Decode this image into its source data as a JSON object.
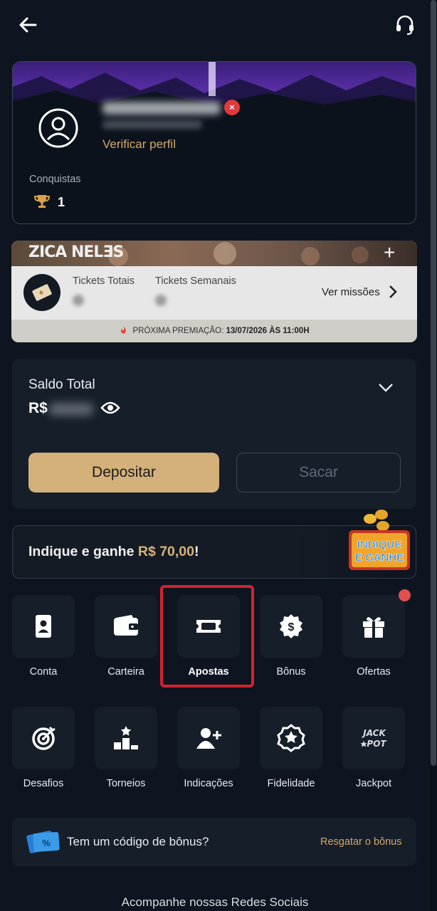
{
  "header": {
    "back_icon": "arrow-left-icon",
    "support_icon": "headset-icon"
  },
  "profile": {
    "verify_label": "Verificar perfil",
    "achievements_label": "Conquistas",
    "achievements_count": "1"
  },
  "missions": {
    "logo": "ZICA NELƎS",
    "plus": "+",
    "tickets_total_label": "Tickets Totais",
    "tickets_weekly_label": "Tickets Semanais",
    "see_missions": "Ver missões",
    "next_prize_label": "PRÓXIMA PREMIAÇÃO:",
    "next_prize_value": "13/07/2026 ÀS 11:00H"
  },
  "balance": {
    "title": "Saldo Total",
    "currency": "R$",
    "deposit_label": "Depositar",
    "withdraw_label": "Sacar"
  },
  "referral": {
    "text": "Indique e ganhe ",
    "amount": "R$ 70,00",
    "suffix": "!",
    "badge_line1": "INDIQUE",
    "badge_line2": "E GANHE"
  },
  "menu_row1": [
    {
      "label": "Conta",
      "icon": "id-card-icon"
    },
    {
      "label": "Carteira",
      "icon": "wallet-icon"
    },
    {
      "label": "Apostas",
      "icon": "ticket-icon"
    },
    {
      "label": "Bônus",
      "icon": "dollar-badge-icon"
    },
    {
      "label": "Ofertas",
      "icon": "gift-icon"
    }
  ],
  "menu_row2": [
    {
      "label": "Desafios",
      "icon": "target-icon"
    },
    {
      "label": "Torneios",
      "icon": "podium-icon"
    },
    {
      "label": "Indicações",
      "icon": "add-user-icon"
    },
    {
      "label": "Fidelidade",
      "icon": "star-medal-icon"
    },
    {
      "label": "Jackpot",
      "icon": "jackpot-icon"
    }
  ],
  "bonus_code": {
    "question": "Tem um código de bônus?",
    "redeem_label": "Resgatar o bônus"
  },
  "footer": {
    "social_label": "Acompanhe nossas Redes Sociais"
  },
  "colors": {
    "accent_gold": "#d4b07a",
    "background": "#0e1520",
    "highlight_red": "#d1232f"
  }
}
